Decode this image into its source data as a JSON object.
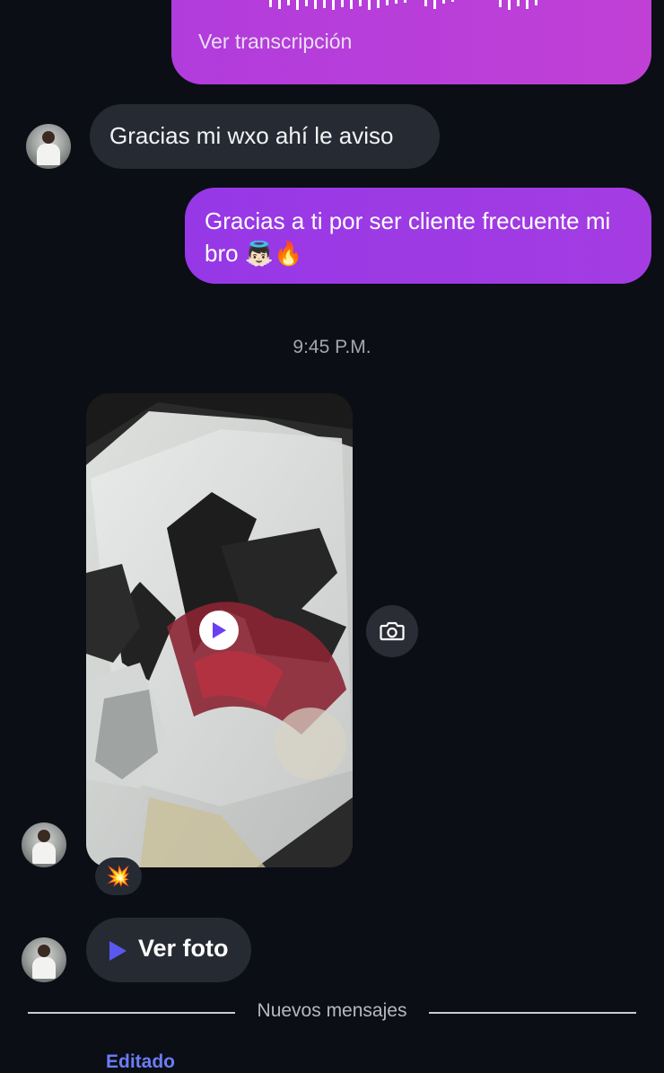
{
  "voice_message": {
    "transcript_link": "Ver transcripción"
  },
  "messages": [
    {
      "direction": "incoming",
      "text": "Gracias mi wxo ahí le aviso"
    },
    {
      "direction": "outgoing",
      "text": "Gracias a ti por ser cliente frecuente mi bro 👼🏻🔥"
    }
  ],
  "timestamp": "9:45 P.M.",
  "video_message": {
    "reaction": "💥",
    "play_icon": "play-icon",
    "save_icon": "camera-icon"
  },
  "view_photo": {
    "label": "Ver foto",
    "icon": "play-icon"
  },
  "divider": {
    "label": "Nuevos mensajes"
  },
  "edited_label": "Editado",
  "colors": {
    "background": "#0b0e14",
    "incoming_bubble": "#262a33",
    "outgoing_bubble": "#9a3fe0",
    "accent_link": "#6b7df5"
  }
}
